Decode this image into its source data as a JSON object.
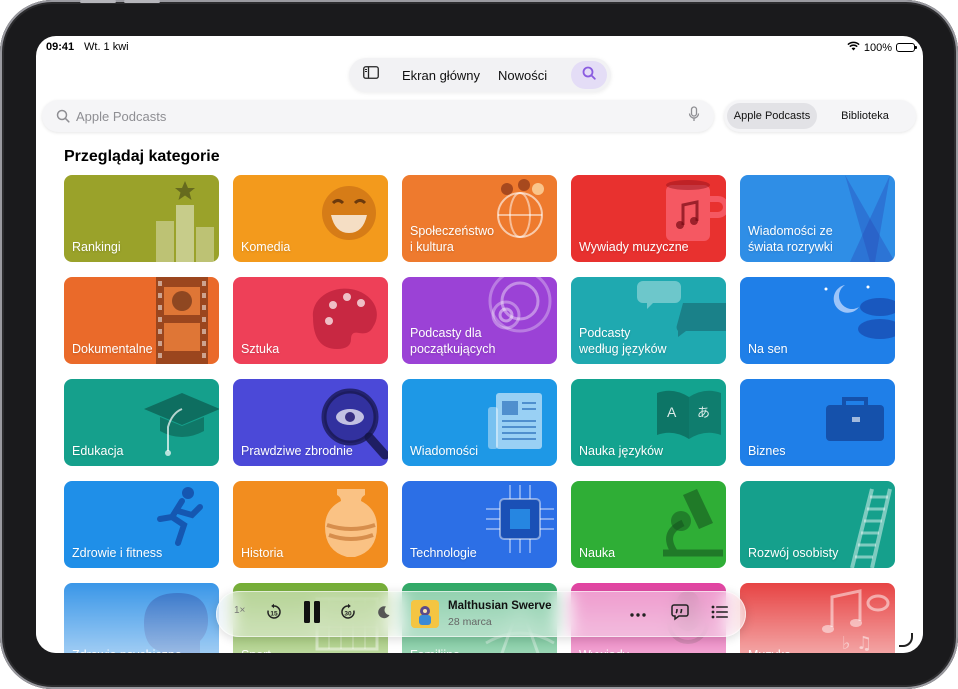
{
  "status": {
    "time": "09:41",
    "date": "Wt. 1 kwi",
    "battery": "100%"
  },
  "nav": {
    "home": "Ekran główny",
    "new": "Nowości"
  },
  "search": {
    "placeholder": "Apple Podcasts"
  },
  "scope": {
    "active": "Apple Podcasts",
    "library": "Biblioteka"
  },
  "section_title": "Przeglądaj kategorie",
  "categories": [
    {
      "label": "Rankingi",
      "color": "#9aa22a",
      "icon": "podium-icon"
    },
    {
      "label": "Komedia",
      "color": "#f39a1c",
      "icon": "laughing-face-icon"
    },
    {
      "label": "Społeczeństwo\ni kultura",
      "color": "#ee7a2e",
      "icon": "people-globe-icon"
    },
    {
      "label": "Wywiady muzyczne",
      "color": "#e8312f",
      "icon": "music-mug-icon"
    },
    {
      "label": "Wiadomości ze\nświata rozrywki",
      "color": "#2f8ee6",
      "icon": "spotlight-icon"
    },
    {
      "label": "Dokumentalne",
      "color": "#ea6a2a",
      "icon": "film-strip-icon"
    },
    {
      "label": "Sztuka",
      "color": "#ee4058",
      "icon": "palette-icon"
    },
    {
      "label": "Podcasty dla\npoczątkujących",
      "color": "#9b42d6",
      "icon": "rings-icon"
    },
    {
      "label": "Podcasty\nwedług języków",
      "color": "#1fa9b0",
      "icon": "speech-bubbles-icon"
    },
    {
      "label": "Na sen",
      "color": "#1f7fe8",
      "icon": "moon-clouds-icon"
    },
    {
      "label": "Edukacja",
      "color": "#15a08c",
      "icon": "graduation-cap-icon"
    },
    {
      "label": "Prawdziwe zbrodnie",
      "color": "#4b49d8",
      "icon": "magnifying-eye-icon"
    },
    {
      "label": "Wiadomości",
      "color": "#1e98e6",
      "icon": "newspaper-icon"
    },
    {
      "label": "Nauka języków",
      "color": "#13a38f",
      "icon": "language-book-icon"
    },
    {
      "label": "Biznes",
      "color": "#1f7fe8",
      "icon": "briefcase-icon"
    },
    {
      "label": "Zdrowie i fitness",
      "color": "#1f8fe8",
      "icon": "runner-icon"
    },
    {
      "label": "Historia",
      "color": "#f28d1f",
      "icon": "amphora-icon"
    },
    {
      "label": "Technologie",
      "color": "#2c6fe6",
      "icon": "chip-icon"
    },
    {
      "label": "Nauka",
      "color": "#2fae36",
      "icon": "microscope-icon"
    },
    {
      "label": "Rozwój osobisty",
      "color": "#15a08c",
      "icon": "ladder-icon"
    },
    {
      "label": "Zdrowie psychiczne",
      "color": "#2a8ee6",
      "icon": "head-icon"
    },
    {
      "label": "Sport",
      "color": "#6aa825",
      "icon": "goal-icon"
    },
    {
      "label": "Familijne",
      "color": "#1fa35a",
      "icon": "family-icon"
    },
    {
      "label": "Wywiady",
      "color": "#e0339a",
      "icon": "microphone-icon"
    },
    {
      "label": "Muzyka",
      "color": "#e53535",
      "icon": "music-notes-icon"
    }
  ],
  "player": {
    "speed": "1×",
    "title": "Malthusian Swerve",
    "date": "28 marca",
    "skip_back": "15",
    "skip_forward": "30"
  }
}
